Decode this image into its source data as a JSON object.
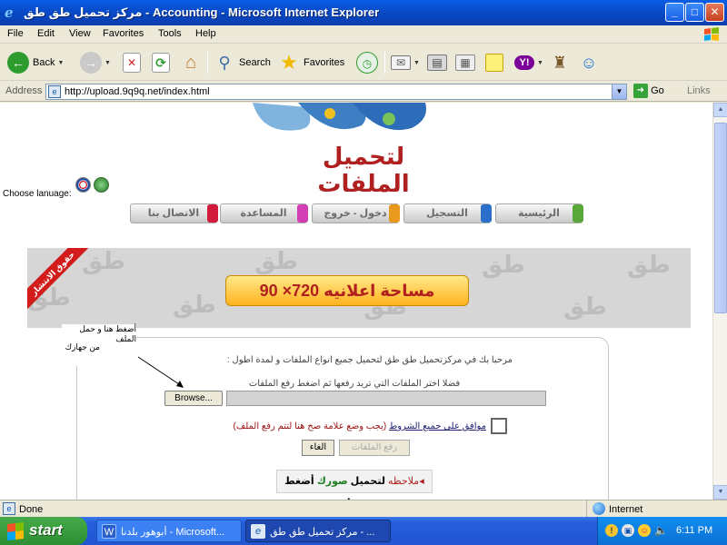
{
  "window": {
    "title": "مركز تحميل طق طق - Accounting - Microsoft Internet Explorer",
    "buttons": {
      "minimize": "_",
      "maximize": "□",
      "close": "✕"
    }
  },
  "menu": [
    "File",
    "Edit",
    "View",
    "Favorites",
    "Tools",
    "Help"
  ],
  "toolbar": {
    "back": "Back",
    "search": "Search",
    "favorites": "Favorites"
  },
  "address": {
    "label": "Address",
    "url": "http://upload.9q9q.net/index.html",
    "go": "Go",
    "links": "Links"
  },
  "page": {
    "logo_text": "لتحميل الملفات",
    "language_label": "Choose lanuage:",
    "nav_tabs": [
      {
        "label": "الرئيسية",
        "color": "#5aa83a"
      },
      {
        "label": "التسجيل",
        "color": "#2a6fc9"
      },
      {
        "label": "دخول - خروج",
        "color": "#e89a1e"
      },
      {
        "label": "المساعدة",
        "color": "#d23fb4"
      },
      {
        "label": "الاتصال بنا",
        "color": "#d21b3a"
      }
    ],
    "ad": {
      "ribbon": "حقوق الانتشار",
      "text": "مساحة اعلانيه  720× 90",
      "watermark": "طق"
    },
    "tooltip": {
      "line1": "أضغط هنا و حمل الملف",
      "line2": "من جهازك"
    },
    "welcome": "مرحبا بك في مركزتحميل طق طق لتحميل جميع انواع الملفات و لمدة اطول :",
    "choose_hint": "فضلا اختر الملفات التي تريد رفعها ثم اضغط رفع الملفات",
    "browse_button": "Browse...",
    "terms": {
      "agree": "موافق على جميع الشروط",
      "note": "(يجب وضع علامة صح هنا لتتم رفع الملف)"
    },
    "upload_button": "رفع الملفات",
    "cancel_button": "الغاء",
    "note": {
      "marker": "ملاحظه",
      "text1": "لتحميل",
      "pics": "صورك",
      "text2": "أضغط هنا"
    }
  },
  "status": {
    "text": "Done",
    "zone": "Internet"
  },
  "taskbar": {
    "start": "start",
    "buttons": [
      {
        "label": "أبوهور بلدنا - Microsoft...",
        "active": false
      },
      {
        "label": "مركز تحميل طق طق - ...",
        "active": true
      }
    ],
    "clock": "6:11 PM"
  },
  "colors": {
    "title_blue": "#0848c4",
    "taskbar_blue": "#245edb",
    "start_green": "#3aa53e",
    "logo_red": "#b02020"
  }
}
